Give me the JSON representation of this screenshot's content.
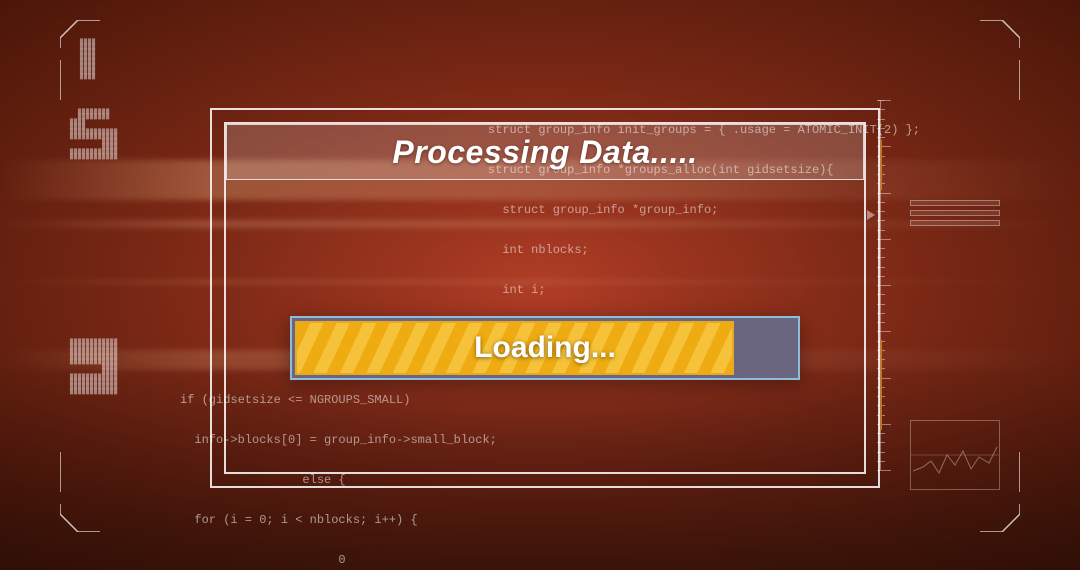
{
  "dialog": {
    "title": "Processing Data.....",
    "loading_label": "Loading..."
  },
  "progress": {
    "percent": 88
  },
  "colors": {
    "accent_yellow": "#f0b830",
    "accent_border": "#e8a820",
    "panel_border": "#ffffff",
    "progress_frame": "#8fbcd9",
    "hud_orange": "#f4a940"
  },
  "background_code": {
    "right_block": "struct group_info init_groups = { .usage = ATOMIC_INIT(2) };\n\nstruct group_info *groups_alloc(int gidsetsize){\n\n  struct group_info *group_info;\n\n  int nblocks;\n\n  int i;\n\n\n\n  nblocks = (gidsetsize + NGROUPS_PER_",
    "left_block": "if (gidsetsize <= NGROUPS_SMALL)\n\n  info->blocks[0] = group_info->small_block;\n\n                 else {\n\n  for (i = 0; i < nblocks; i++) {\n\n                      0"
  }
}
